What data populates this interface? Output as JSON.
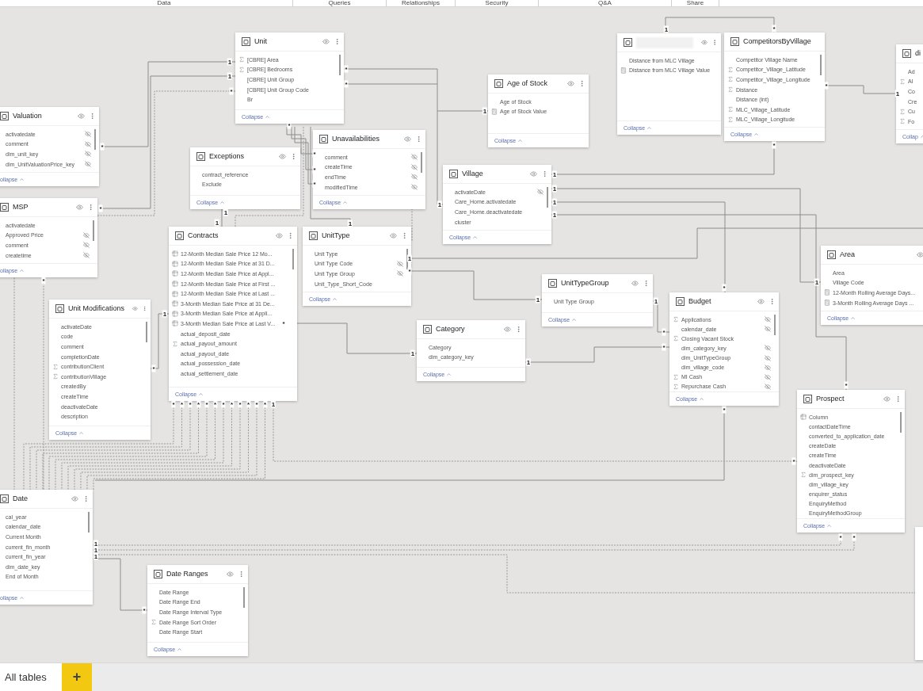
{
  "top_tabs": [
    {
      "label": "Data"
    },
    {
      "label": "Queries"
    },
    {
      "label": "Relationships"
    },
    {
      "label": "Security"
    },
    {
      "label": "Q&A"
    },
    {
      "label": "Share"
    }
  ],
  "tables": [
    {
      "title": "Unit",
      "collapse": "Collapse",
      "fields": [
        {
          "name": "[CBRE] Area",
          "kind": "sigma",
          "hidden": false
        },
        {
          "name": "[CBRE] Bedrooms",
          "kind": "sigma",
          "hidden": false
        },
        {
          "name": "[CBRE] Unit Group",
          "kind": "plain",
          "hidden": false
        },
        {
          "name": "[CBRE] Unit Group Code",
          "kind": "plain",
          "hidden": false
        },
        {
          "name": "Br",
          "kind": "plain",
          "hidden": false
        }
      ]
    },
    {
      "title": "Age of Stock",
      "collapse": "Collapse",
      "fields": [
        {
          "name": "Age of Stock",
          "kind": "plain",
          "hidden": false
        },
        {
          "name": "Age of Stock Value",
          "kind": "measure",
          "hidden": false
        }
      ]
    },
    {
      "collapse": "Collapse",
      "fields": [
        {
          "name": "Distance from MLC Village",
          "kind": "plain",
          "hidden": false
        },
        {
          "name": "Distance from MLC Village Value",
          "kind": "measure",
          "hidden": false
        }
      ]
    },
    {
      "title": "CompetitorsByVillage",
      "collapse": "Collapse",
      "fields": [
        {
          "name": "Competitor Village Name",
          "kind": "plain",
          "hidden": false
        },
        {
          "name": "Competitor_Village_Latitude",
          "kind": "sigma",
          "hidden": false
        },
        {
          "name": "Competitor_Village_Longitude",
          "kind": "sigma",
          "hidden": false
        },
        {
          "name": "Distance",
          "kind": "sigma",
          "hidden": false
        },
        {
          "name": "Distance (int)",
          "kind": "plain",
          "hidden": false
        },
        {
          "name": "MLC_Village_Latitude",
          "kind": "sigma",
          "hidden": false
        },
        {
          "name": "MLC_Village_Longitude",
          "kind": "sigma",
          "hidden": false
        }
      ]
    },
    {
      "title": "di",
      "collapse": "Collap",
      "fields": [
        {
          "name": "Ad",
          "kind": "plain",
          "hidden": false
        },
        {
          "name": "Al",
          "kind": "sigma",
          "hidden": false
        },
        {
          "name": "Co",
          "kind": "plain",
          "hidden": false
        },
        {
          "name": "Cre",
          "kind": "plain",
          "hidden": false
        },
        {
          "name": "Cu",
          "kind": "sigma",
          "hidden": false
        },
        {
          "name": "Fo",
          "kind": "sigma",
          "hidden": false
        }
      ]
    },
    {
      "title": "Valuation",
      "collapse": "ollapse",
      "fields": [
        {
          "name": "activatedate",
          "kind": "plain",
          "hidden": true
        },
        {
          "name": "comment",
          "kind": "plain",
          "hidden": true
        },
        {
          "name": "dim_unit_key",
          "kind": "plain",
          "hidden": true
        },
        {
          "name": "dim_UnitValuationPrice_key",
          "kind": "plain",
          "hidden": true
        }
      ]
    },
    {
      "title": "Exceptions",
      "collapse": "Collapse",
      "fields": [
        {
          "name": "contract_reference",
          "kind": "plain",
          "hidden": false
        },
        {
          "name": "Exclude",
          "kind": "plain",
          "hidden": false
        }
      ]
    },
    {
      "title": "Unavailabilities",
      "collapse": "Collapse",
      "fields": [
        {
          "name": "comment",
          "kind": "plain",
          "hidden": true
        },
        {
          "name": "createTime",
          "kind": "plain",
          "hidden": true
        },
        {
          "name": "endTime",
          "kind": "plain",
          "hidden": true
        },
        {
          "name": "modifiedTime",
          "kind": "plain",
          "hidden": true
        }
      ]
    },
    {
      "title": "Village",
      "collapse": "Collapse",
      "fields": [
        {
          "name": "activateDate",
          "kind": "plain",
          "hidden": true
        },
        {
          "name": "Care_Home.activatedate",
          "kind": "plain",
          "hidden": false
        },
        {
          "name": "Care_Home.deactivatedate",
          "kind": "plain",
          "hidden": false
        },
        {
          "name": "cluster",
          "kind": "plain",
          "hidden": false
        }
      ]
    },
    {
      "title": "MSP",
      "collapse": "ollapse",
      "fields": [
        {
          "name": "activatedate",
          "kind": "plain",
          "hidden": false
        },
        {
          "name": "Approved Price",
          "kind": "plain",
          "hidden": true
        },
        {
          "name": "comment",
          "kind": "plain",
          "hidden": true
        },
        {
          "name": "createtime",
          "kind": "plain",
          "hidden": true
        }
      ]
    },
    {
      "title": "Contracts",
      "collapse": "Collapse",
      "fields": [
        {
          "name": "12-Month Median Sale Price 12 Mo...",
          "kind": "calc",
          "hidden": false
        },
        {
          "name": "12-Month Median Sale Price at 31 D...",
          "kind": "calc",
          "hidden": false
        },
        {
          "name": "12-Month Median Sale Price at Appl...",
          "kind": "calc",
          "hidden": false
        },
        {
          "name": "12-Month Median Sale Price at First ...",
          "kind": "calc",
          "hidden": false
        },
        {
          "name": "12-Month Median Sale Price at Last ...",
          "kind": "calc",
          "hidden": false
        },
        {
          "name": "3-Month Median Sale Price at 31 De...",
          "kind": "calc",
          "hidden": false
        },
        {
          "name": "3-Month Median Sale Price at Appli...",
          "kind": "calc",
          "hidden": false
        },
        {
          "name": "3-Month Median Sale Price at Last V...",
          "kind": "calc",
          "hidden": false
        },
        {
          "name": "actual_deposit_date",
          "kind": "plain",
          "hidden": false
        },
        {
          "name": "actual_payout_amount",
          "kind": "sigma",
          "hidden": false
        },
        {
          "name": "actual_payout_date",
          "kind": "plain",
          "hidden": false
        },
        {
          "name": "actual_possession_date",
          "kind": "plain",
          "hidden": false
        },
        {
          "name": "actual_settlement_date",
          "kind": "plain",
          "hidden": false
        }
      ]
    },
    {
      "title": "UnitType",
      "collapse": "Collapse",
      "fields": [
        {
          "name": "Unit Type",
          "kind": "plain",
          "hidden": false
        },
        {
          "name": "Unit Type Code",
          "kind": "plain",
          "hidden": true
        },
        {
          "name": "Unit Type Group",
          "kind": "plain",
          "hidden": true
        },
        {
          "name": "Unit_Type_Short_Code",
          "kind": "plain",
          "hidden": false
        }
      ]
    },
    {
      "title": "UnitTypeGroup",
      "collapse": "Collapse",
      "fields": [
        {
          "name": "Unit Type Group",
          "kind": "plain",
          "hidden": false
        }
      ]
    },
    {
      "title": "Area",
      "collapse": "Collapse",
      "fields": [
        {
          "name": "Area",
          "kind": "plain",
          "hidden": false
        },
        {
          "name": "Village Code",
          "kind": "plain",
          "hidden": false
        },
        {
          "name": "12-Month Rolling Average Days...",
          "kind": "measure",
          "hidden": false
        },
        {
          "name": "3-Month Rolling Average Days ...",
          "kind": "measure",
          "hidden": false
        }
      ]
    },
    {
      "title": "Unit Modifications",
      "collapse": "Collapse",
      "fields": [
        {
          "name": "activateDate",
          "kind": "plain",
          "hidden": false
        },
        {
          "name": "code",
          "kind": "plain",
          "hidden": false
        },
        {
          "name": "comment",
          "kind": "plain",
          "hidden": false
        },
        {
          "name": "completionDate",
          "kind": "plain",
          "hidden": false
        },
        {
          "name": "contributionClient",
          "kind": "sigma",
          "hidden": false
        },
        {
          "name": "contributionVillage",
          "kind": "sigma",
          "hidden": false
        },
        {
          "name": "createdBy",
          "kind": "plain",
          "hidden": false
        },
        {
          "name": "createTime",
          "kind": "plain",
          "hidden": false
        },
        {
          "name": "deactivateDate",
          "kind": "plain",
          "hidden": false
        },
        {
          "name": "description",
          "kind": "plain",
          "hidden": false
        }
      ]
    },
    {
      "title": "Category",
      "collapse": "Collapse",
      "fields": [
        {
          "name": "Category",
          "kind": "plain",
          "hidden": false
        },
        {
          "name": "dim_category_key",
          "kind": "plain",
          "hidden": false
        }
      ]
    },
    {
      "title": "Budget",
      "collapse": "Collapse",
      "fields": [
        {
          "name": "Applications",
          "kind": "sigma",
          "hidden": true
        },
        {
          "name": "calendar_date",
          "kind": "plain",
          "hidden": true
        },
        {
          "name": "Closing Vacant Stock",
          "kind": "sigma",
          "hidden": false
        },
        {
          "name": "dim_category_key",
          "kind": "plain",
          "hidden": true
        },
        {
          "name": "dim_UnitTypeGroup",
          "kind": "plain",
          "hidden": true
        },
        {
          "name": "dim_village_code",
          "kind": "plain",
          "hidden": true
        },
        {
          "name": "MI Cash",
          "kind": "sigma",
          "hidden": true
        },
        {
          "name": "Repurchase Cash",
          "kind": "sigma",
          "hidden": true
        }
      ]
    },
    {
      "title": "Prospect",
      "collapse": "Collapse",
      "fields": [
        {
          "name": "Column",
          "kind": "calc",
          "hidden": false
        },
        {
          "name": "contactDateTime",
          "kind": "plain",
          "hidden": false
        },
        {
          "name": "converted_to_application_date",
          "kind": "plain",
          "hidden": false
        },
        {
          "name": "createDate",
          "kind": "plain",
          "hidden": false
        },
        {
          "name": "createTime",
          "kind": "plain",
          "hidden": false
        },
        {
          "name": "deactivateDate",
          "kind": "plain",
          "hidden": false
        },
        {
          "name": "dim_prospect_key",
          "kind": "sigma",
          "hidden": false
        },
        {
          "name": "dim_village_key",
          "kind": "plain",
          "hidden": false
        },
        {
          "name": "enquirer_status",
          "kind": "plain",
          "hidden": false
        },
        {
          "name": "EnquiryMethod",
          "kind": "plain",
          "hidden": false
        },
        {
          "name": "EnquiryMethodGroup",
          "kind": "plain",
          "hidden": false
        }
      ]
    },
    {
      "title": "Date",
      "collapse": "ollapse",
      "fields": [
        {
          "name": "cal_year",
          "kind": "plain",
          "hidden": false
        },
        {
          "name": "calendar_date",
          "kind": "plain",
          "hidden": false
        },
        {
          "name": "Current Month",
          "kind": "plain",
          "hidden": false
        },
        {
          "name": "current_fin_month",
          "kind": "plain",
          "hidden": false
        },
        {
          "name": "current_fin_year",
          "kind": "plain",
          "hidden": false
        },
        {
          "name": "dim_date_key",
          "kind": "plain",
          "hidden": false
        },
        {
          "name": "End of Month",
          "kind": "plain",
          "hidden": false
        }
      ]
    },
    {
      "title": "Date Ranges",
      "collapse": "Collapse",
      "fields": [
        {
          "name": "Date Range",
          "kind": "plain",
          "hidden": false
        },
        {
          "name": "Date Range End",
          "kind": "plain",
          "hidden": false
        },
        {
          "name": "Date Range Interval Type",
          "kind": "plain",
          "hidden": false
        },
        {
          "name": "Date Range Sort Order",
          "kind": "sigma",
          "hidden": false
        },
        {
          "name": "Date Range Start",
          "kind": "plain",
          "hidden": false
        }
      ]
    }
  ],
  "cardinality_markers": [
    "1",
    "1",
    "*",
    "*",
    "*",
    "1",
    "*",
    "*",
    "1",
    "*",
    "*",
    "*",
    "*",
    "*",
    "1",
    "*",
    "1",
    "1",
    "1",
    "1",
    "1",
    "*",
    "1",
    "1",
    "1",
    "1",
    "*",
    "*",
    "1",
    "*",
    "1",
    "1",
    "1",
    "*",
    "*",
    "*",
    "1",
    "1",
    "*",
    "*",
    "*",
    "*",
    "*",
    "*",
    "*",
    "*",
    "*",
    "*",
    "*",
    "*",
    "*",
    "*",
    "1",
    "*",
    "*",
    "*",
    "*",
    "1",
    "1",
    "1",
    "*"
  ],
  "bottom_tabs": [
    {
      "label": "All tables",
      "selected": true
    }
  ],
  "add_button": "+"
}
